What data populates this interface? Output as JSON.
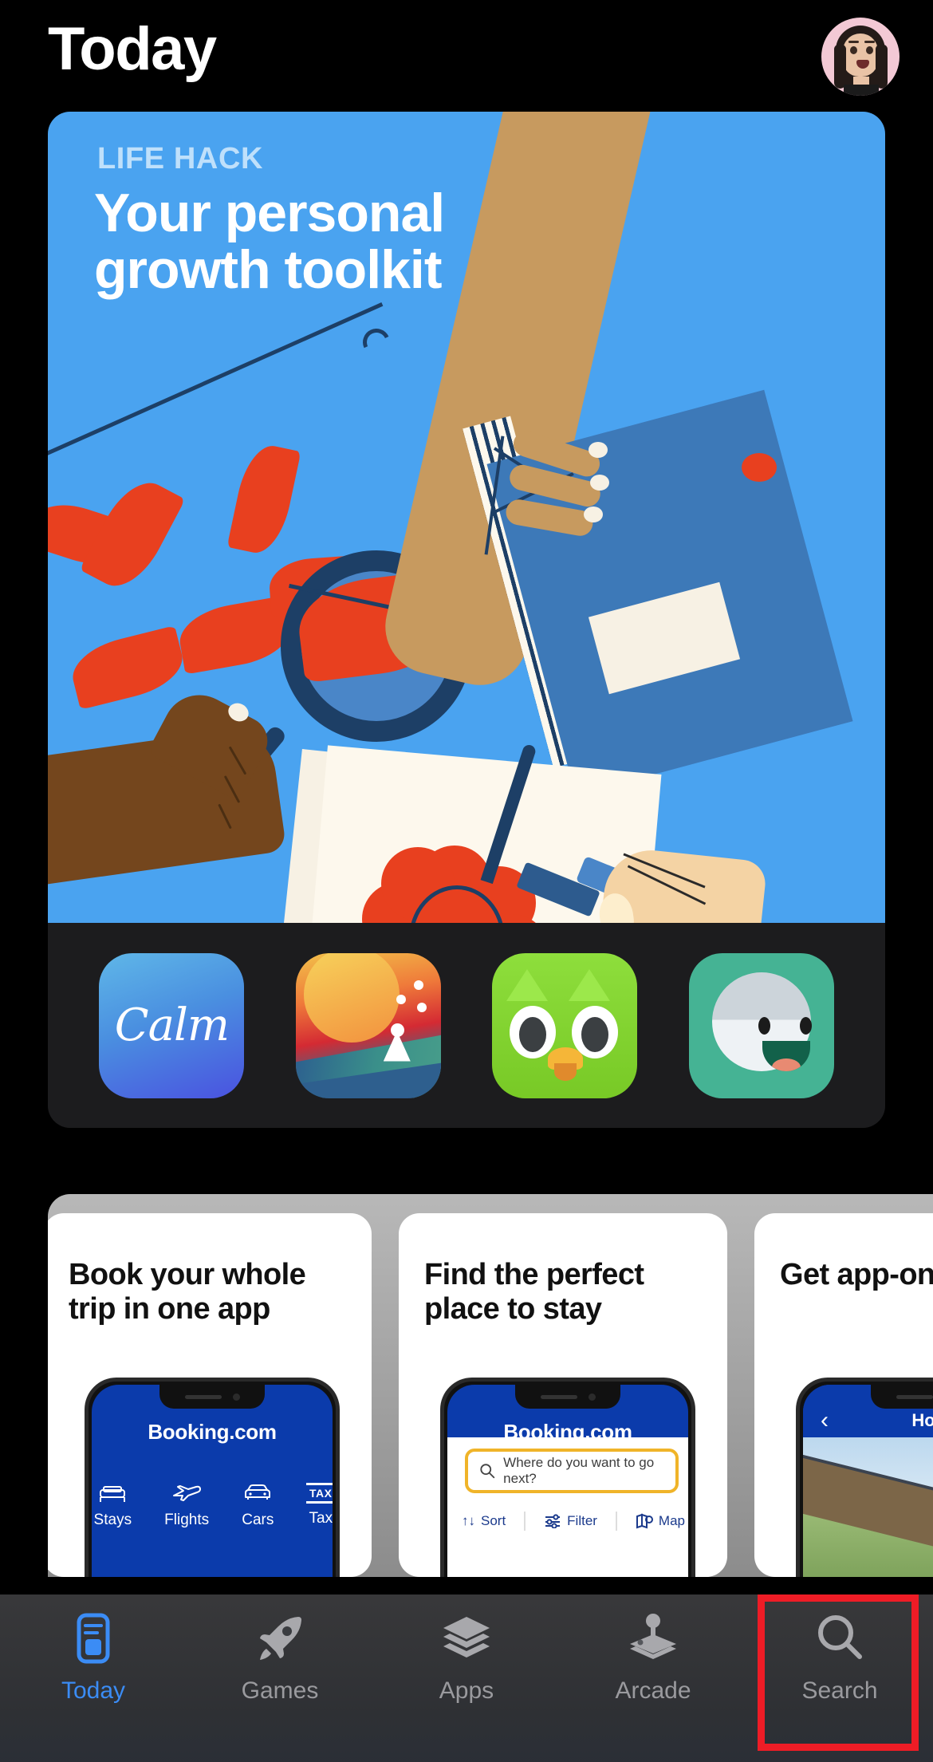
{
  "header": {
    "title": "Today",
    "avatar_name": "memoji-avatar"
  },
  "hero": {
    "eyebrow": "LIFE HACK",
    "title": "Your personal growth toolkit",
    "bg_color": "#4aa3f0",
    "apps": [
      {
        "name": "Calm",
        "icon_name": "calm-app-icon",
        "wordmark": "Calm"
      },
      {
        "name": "Alto",
        "icon_name": "alto-app-icon",
        "wordmark": ""
      },
      {
        "name": "Duolingo",
        "icon_name": "duolingo-app-icon",
        "wordmark": ""
      },
      {
        "name": "Headspace",
        "icon_name": "teal-face-app-icon",
        "wordmark": ""
      }
    ]
  },
  "booking_section": {
    "cards": [
      {
        "title": "Book your whole trip in one app",
        "app_name": "Booking.com",
        "tabs": [
          {
            "label": "Stays",
            "icon": "bed-icon"
          },
          {
            "label": "Flights",
            "icon": "plane-icon"
          },
          {
            "label": "Cars",
            "icon": "car-icon"
          },
          {
            "label": "Taxi",
            "icon": "taxi-icon",
            "glyph": "TAXI"
          }
        ]
      },
      {
        "title": "Find the perfect place to stay",
        "app_name": "Booking.com",
        "search_placeholder": "Where do you want to go next?",
        "toolbar": [
          {
            "label": "Sort",
            "icon": "sort-icon",
            "glyph": "↑↓"
          },
          {
            "label": "Filter",
            "icon": "filter-icon"
          },
          {
            "label": "Map",
            "icon": "map-icon"
          }
        ]
      },
      {
        "title": "Get app-only deals",
        "nav_title": "Ho",
        "back_glyph": "‹"
      }
    ]
  },
  "tabbar": {
    "items": [
      {
        "label": "Today",
        "icon_name": "today-card-icon",
        "active": true
      },
      {
        "label": "Games",
        "icon_name": "rocket-icon",
        "active": false
      },
      {
        "label": "Apps",
        "icon_name": "stacked-layers-icon",
        "active": false
      },
      {
        "label": "Arcade",
        "icon_name": "joystick-icon",
        "active": false
      },
      {
        "label": "Search",
        "icon_name": "magnifier-icon",
        "active": false
      }
    ],
    "active_color": "#3b8cf5",
    "inactive_color": "#9a9a9e"
  },
  "highlight": {
    "target": "Search",
    "color": "#ee1c26"
  }
}
